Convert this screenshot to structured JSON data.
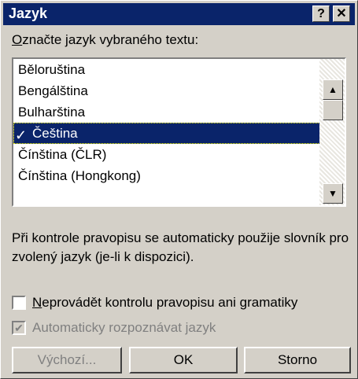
{
  "window": {
    "title": "Jazyk",
    "help_glyph": "?",
    "close_glyph": "✕"
  },
  "prompt": {
    "accel": "O",
    "rest": "značte jazyk vybraného textu:"
  },
  "languages": {
    "selected_index": 3,
    "items": [
      {
        "label": "Běloruština",
        "checked": false
      },
      {
        "label": "Bengálština",
        "checked": false
      },
      {
        "label": "Bulharština",
        "checked": false
      },
      {
        "label": "Čeština",
        "checked": true
      },
      {
        "label": "Čínština (ČLR)",
        "checked": false
      },
      {
        "label": "Čínština (Hongkong)",
        "checked": false
      }
    ],
    "scroll_up_glyph": "▲",
    "scroll_down_glyph": "▼"
  },
  "info_text": "Při kontrole pravopisu se automaticky použije slovník pro zvolený jazyk (je-li k dispozici).",
  "options": {
    "no_check": {
      "accel": "N",
      "rest": "eprovádět kontrolu pravopisu ani gramatiky",
      "checked": false
    },
    "auto_detect": {
      "label": "Automaticky rozpoznávat jazyk",
      "checked": true,
      "disabled": true,
      "check_glyph": "✔"
    }
  },
  "buttons": {
    "default": "Výchozí...",
    "ok": "OK",
    "cancel": "Storno"
  },
  "colors": {
    "titlebar": "#0a246a",
    "selection": "#0a246a",
    "face": "#d4d0c8"
  }
}
